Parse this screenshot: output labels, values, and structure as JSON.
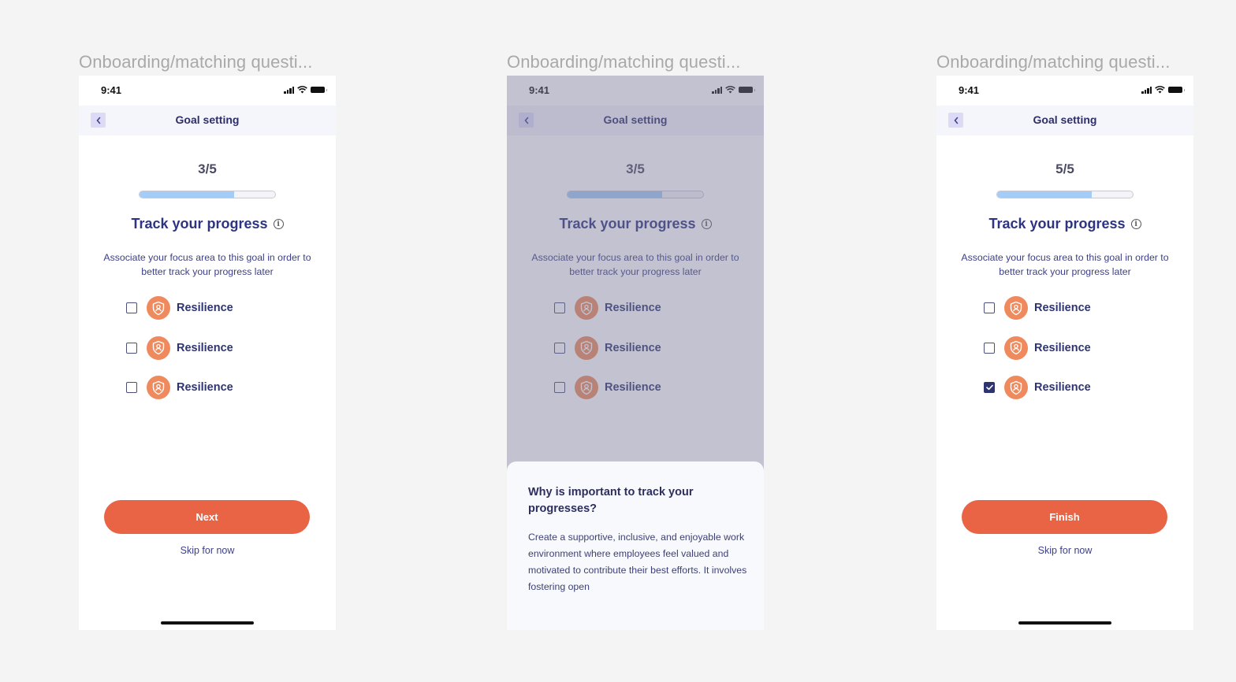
{
  "frames": [
    {
      "label": "Onboarding/matching questi...",
      "status_time": "9:41",
      "nav_title": "Goal setting",
      "step": "3/5",
      "progress": 0.7,
      "heading": "Track your progress",
      "description": "Associate your focus area to this goal in order to better track your progress later",
      "options": [
        {
          "label": "Resilience",
          "checked": false,
          "icon": "shield-user-icon"
        },
        {
          "label": "Resilience",
          "checked": false,
          "icon": "shield-user-icon"
        },
        {
          "label": "Resilience",
          "checked": false,
          "icon": "shield-user-icon"
        }
      ],
      "primary_button": "Next",
      "skip_link": "Skip for now"
    },
    {
      "label": "Onboarding/matching questi...",
      "status_time": "9:41",
      "nav_title": "Goal setting",
      "step": "3/5",
      "progress": 0.7,
      "heading": "Track your progress",
      "description": "Associate your focus area to this goal in order to better track your progress later",
      "options": [
        {
          "label": "Resilience",
          "checked": false,
          "icon": "shield-user-icon"
        },
        {
          "label": "Resilience",
          "checked": false,
          "icon": "shield-user-icon"
        },
        {
          "label": "Resilience",
          "checked": false,
          "icon": "shield-user-icon"
        }
      ],
      "sheet": {
        "title": "Why is important to track your progresses?",
        "body": "Create a supportive, inclusive, and enjoyable work environment where employees feel valued and motivated to contribute their best efforts. It involves fostering open"
      }
    },
    {
      "label": "Onboarding/matching questi...",
      "status_time": "9:41",
      "nav_title": "Goal setting",
      "step": "5/5",
      "progress": 0.7,
      "heading": "Track your progress",
      "description": "Associate your focus area to this goal in order to better track your progress later",
      "options": [
        {
          "label": "Resilience",
          "checked": false,
          "icon": "shield-user-icon"
        },
        {
          "label": "Resilience",
          "checked": false,
          "icon": "shield-user-icon"
        },
        {
          "label": "Resilience",
          "checked": true,
          "icon": "shield-user-icon"
        }
      ],
      "primary_button": "Finish",
      "skip_link": "Skip for now"
    }
  ],
  "colors": {
    "primary": "#e96444",
    "navy": "#2e3470",
    "progress_fill": "#a3cdf7",
    "icon_bg": "#ee8a5d",
    "overlay": "#c3c3cf"
  }
}
